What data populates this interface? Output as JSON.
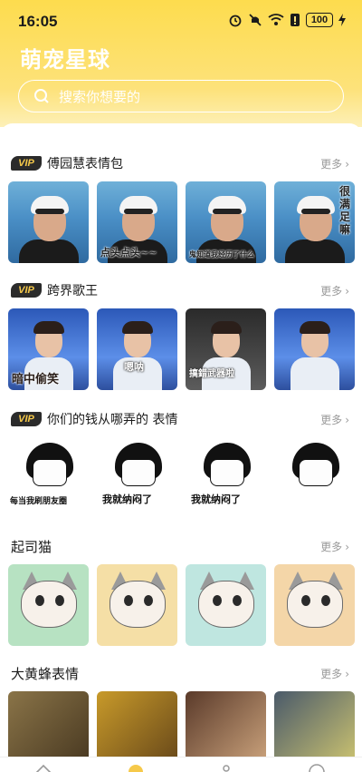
{
  "status": {
    "time": "16:05",
    "battery": "100"
  },
  "app": {
    "title": "萌宠星球"
  },
  "search": {
    "placeholder": "搜索你想要的"
  },
  "common": {
    "vip": "VIP",
    "more": "更多"
  },
  "sections": [
    {
      "title": "傅园慧表情包",
      "vip": true,
      "captions": [
        "",
        "点头点头~~",
        "鬼知道我经历了什么",
        "很满足嘛"
      ]
    },
    {
      "title": "跨界歌王",
      "vip": true,
      "captions": [
        "暗中偷笑",
        "嗯呐",
        "搞錯武器啦",
        ""
      ]
    },
    {
      "title": "你们的钱从哪弄的 表情",
      "vip": true,
      "captions": [
        "每当我刷朋友圈",
        "我就纳闷了",
        "我就纳闷了",
        ""
      ]
    },
    {
      "title": "起司猫",
      "vip": false,
      "captions": [
        "",
        "",
        "",
        ""
      ]
    },
    {
      "title": "大黄蜂表情",
      "vip": false,
      "captions": [
        "",
        "",
        "",
        ""
      ]
    }
  ],
  "colors": {
    "header": "#fddc4e",
    "vip_badge_bg": "#2b2b2b",
    "vip_badge_text": "#f6c94a"
  }
}
